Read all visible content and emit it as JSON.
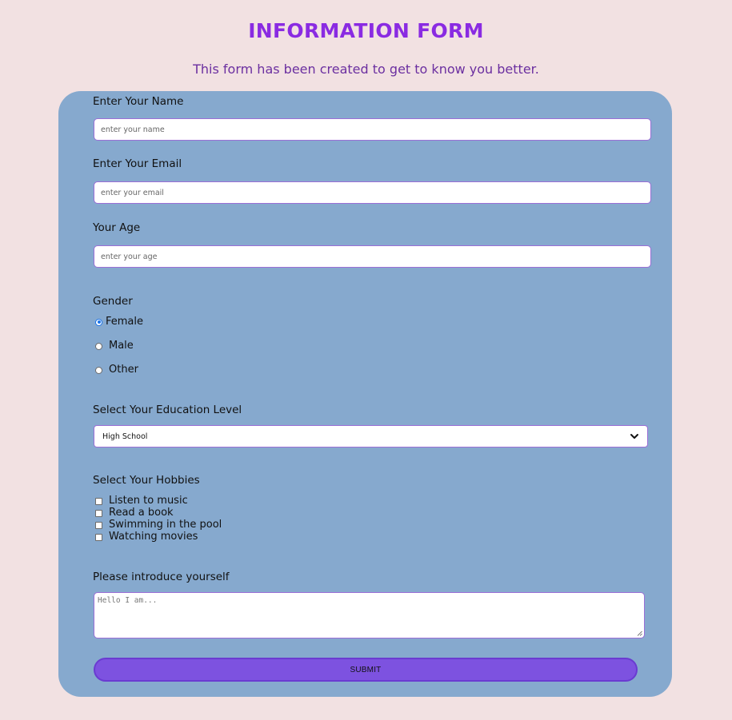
{
  "header": {
    "title": "INFORMATION FORM",
    "subtitle": "This form has been created to get to know you better."
  },
  "form": {
    "name": {
      "label": "Enter Your Name",
      "placeholder": "enter your name",
      "value": ""
    },
    "email": {
      "label": "Enter Your Email",
      "placeholder": "enter your email",
      "value": ""
    },
    "age": {
      "label": "Your Age",
      "placeholder": "enter your age",
      "value": ""
    },
    "gender": {
      "label": "Gender",
      "options": [
        "Female",
        "Male",
        "Other"
      ],
      "selected": "Female"
    },
    "education": {
      "label": "Select Your Education Level",
      "selected": "High School"
    },
    "hobbies": {
      "label": "Select Your Hobbies",
      "options": [
        "Listen to music",
        "Read a book",
        "Swimming in the pool",
        "Watching movies"
      ]
    },
    "intro": {
      "label": "Please introduce yourself",
      "placeholder": "Hello I am..."
    },
    "submit_label": "SUBMIT"
  },
  "colors": {
    "page_background": "#f2e1e2",
    "card_background": "#86a9ce",
    "title": "#8a2be2",
    "accent": "#7d52e0"
  }
}
